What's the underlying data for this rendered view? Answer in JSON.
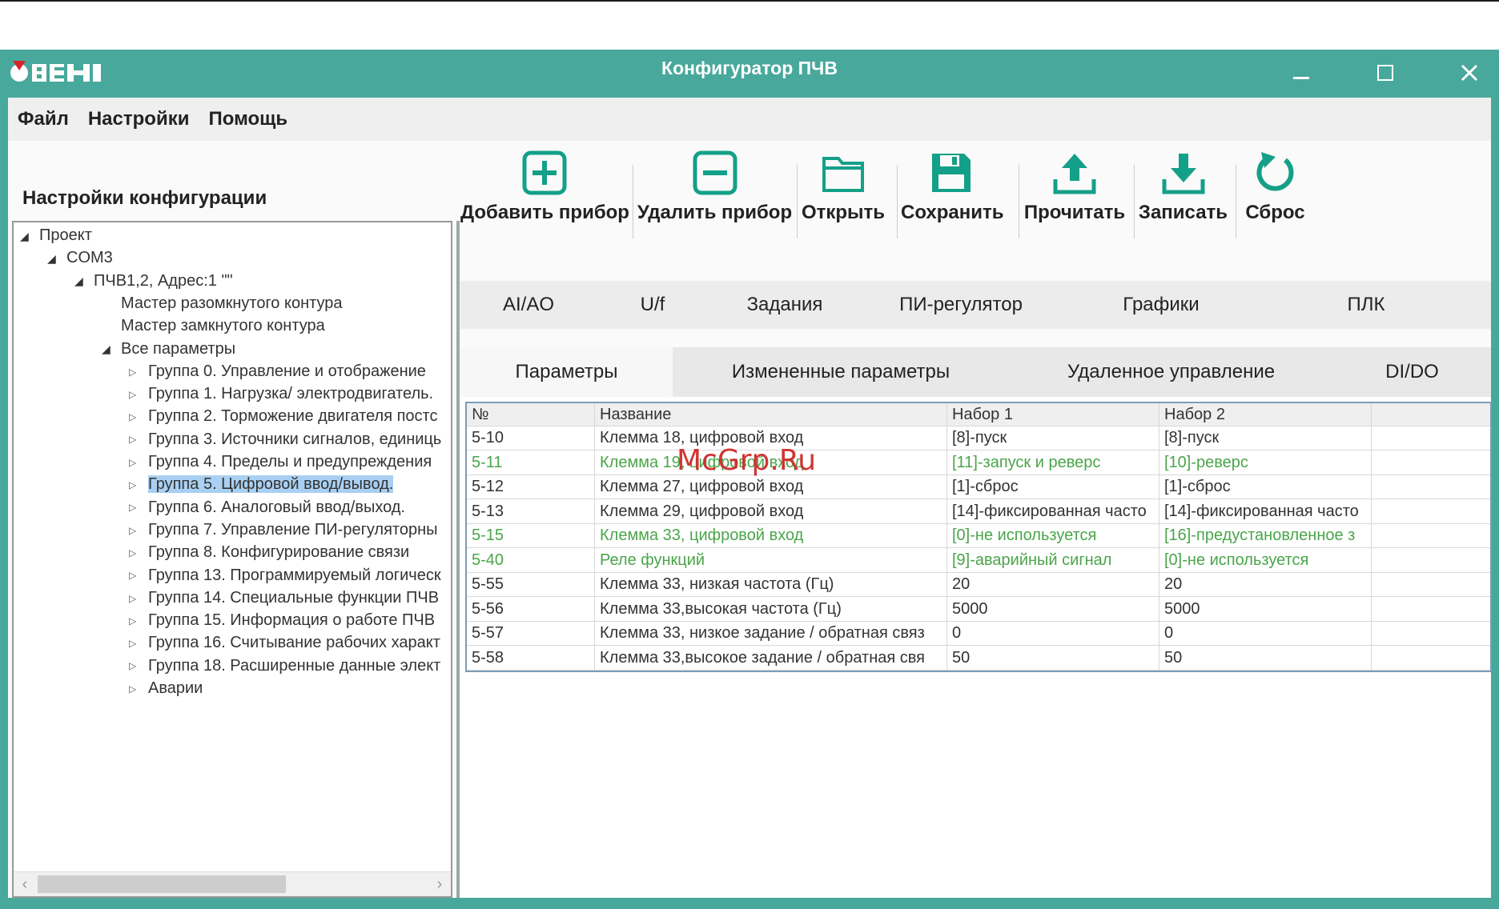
{
  "window": {
    "title": "Конфигуратор ПЧВ",
    "logo_text": "ОВЕН",
    "accent_color": "#48a89c"
  },
  "menu": [
    "Файл",
    "Настройки",
    "Помощь"
  ],
  "sidebar": {
    "heading": "Настройки конфигурации",
    "tree": [
      {
        "label": "Проект",
        "level": 0,
        "toggle": "open"
      },
      {
        "label": "COM3",
        "level": 1,
        "toggle": "open"
      },
      {
        "label": "ПЧВ1,2, Адрес:1 \"\"",
        "level": 2,
        "toggle": "open"
      },
      {
        "label": "Мастер разомкнутого контура",
        "level": 3,
        "toggle": "none"
      },
      {
        "label": "Мастер замкнутого контура",
        "level": 3,
        "toggle": "none"
      },
      {
        "label": "Все параметры",
        "level": 3,
        "toggle": "open"
      },
      {
        "label": "Группа 0. Управление и отображение",
        "level": 4,
        "toggle": "closed"
      },
      {
        "label": "Группа 1. Нагрузка/ электродвигатель.",
        "level": 4,
        "toggle": "closed"
      },
      {
        "label": "Группа 2. Торможение двигателя постс",
        "level": 4,
        "toggle": "closed"
      },
      {
        "label": "Группа 3. Источники сигналов, единиць",
        "level": 4,
        "toggle": "closed"
      },
      {
        "label": "Группа 4. Пределы и предупреждения",
        "level": 4,
        "toggle": "closed"
      },
      {
        "label": "Группа 5. Цифровой ввод/вывод.",
        "level": 4,
        "toggle": "closed",
        "selected": true
      },
      {
        "label": "Группа 6. Аналоговый ввод/выход.",
        "level": 4,
        "toggle": "closed"
      },
      {
        "label": "Группа 7. Управление ПИ-регуляторны",
        "level": 4,
        "toggle": "closed"
      },
      {
        "label": "Группа 8. Конфигурирование связи",
        "level": 4,
        "toggle": "closed"
      },
      {
        "label": "Группа 13. Программируемый логическ",
        "level": 4,
        "toggle": "closed"
      },
      {
        "label": "Группа 14. Специальные функции ПЧВ",
        "level": 4,
        "toggle": "closed"
      },
      {
        "label": "Группа 15. Информация о работе ПЧВ",
        "level": 4,
        "toggle": "closed"
      },
      {
        "label": "Группа 16. Считывание рабочих характ",
        "level": 4,
        "toggle": "closed"
      },
      {
        "label": "Группа 18. Расширенные данные элект",
        "level": 4,
        "toggle": "closed"
      },
      {
        "label": "Аварии",
        "level": 4,
        "toggle": "closed"
      }
    ]
  },
  "toolbar": {
    "add": "Добавить прибор",
    "remove": "Удалить прибор",
    "open": "Открыть",
    "save": "Сохранить",
    "read": "Прочитать",
    "write": "Записать",
    "reset": "Сброс"
  },
  "tabs_top": [
    "AI/AO",
    "U/f",
    "Задания",
    "ПИ-регулятор",
    "Графики",
    "ПЛК"
  ],
  "tabs_second": [
    "Параметры",
    "Измененные параметры",
    "Удаленное управление",
    "DI/DO"
  ],
  "table": {
    "columns": [
      "№",
      "Название",
      "Набор 1",
      "Набор 2"
    ],
    "rows": [
      {
        "no": "5-10",
        "name": "Клемма 18, цифровой вход",
        "set1": "[8]-пуск",
        "set2": "[8]-пуск",
        "changed": false
      },
      {
        "no": "5-11",
        "name": "Клемма 19, цифровой вход",
        "set1": "[11]-запуск и реверс",
        "set2": "[10]-реверс",
        "changed": true
      },
      {
        "no": "5-12",
        "name": "Клемма 27, цифровой вход",
        "set1": "[1]-сброс",
        "set2": "[1]-сброс",
        "changed": false
      },
      {
        "no": "5-13",
        "name": "Клемма 29, цифровой вход",
        "set1": "[14]-фиксированная часто",
        "set2": "[14]-фиксированная часто",
        "changed": false
      },
      {
        "no": "5-15",
        "name": "Клемма 33, цифровой вход",
        "set1": "[0]-не используется",
        "set2": "[16]-предустановленное з",
        "changed": true
      },
      {
        "no": "5-40",
        "name": "Реле функций",
        "set1": "[9]-аварийный сигнал",
        "set2": "[0]-не используется",
        "changed": true
      },
      {
        "no": "5-55",
        "name": "Клемма 33, низкая частота (Гц)",
        "set1": "20",
        "set2": "20",
        "changed": false
      },
      {
        "no": "5-56",
        "name": "Клемма 33,высокая частота (Гц)",
        "set1": "5000",
        "set2": "5000",
        "changed": false
      },
      {
        "no": "5-57",
        "name": "Клемма 33, низкое задание / обратная связ",
        "set1": "0",
        "set2": "0",
        "changed": false
      },
      {
        "no": "5-58",
        "name": "Клемма 33,высокое задание / обратная свя",
        "set1": "50",
        "set2": "50",
        "changed": false
      }
    ]
  },
  "watermark": "McGrp.Ru"
}
